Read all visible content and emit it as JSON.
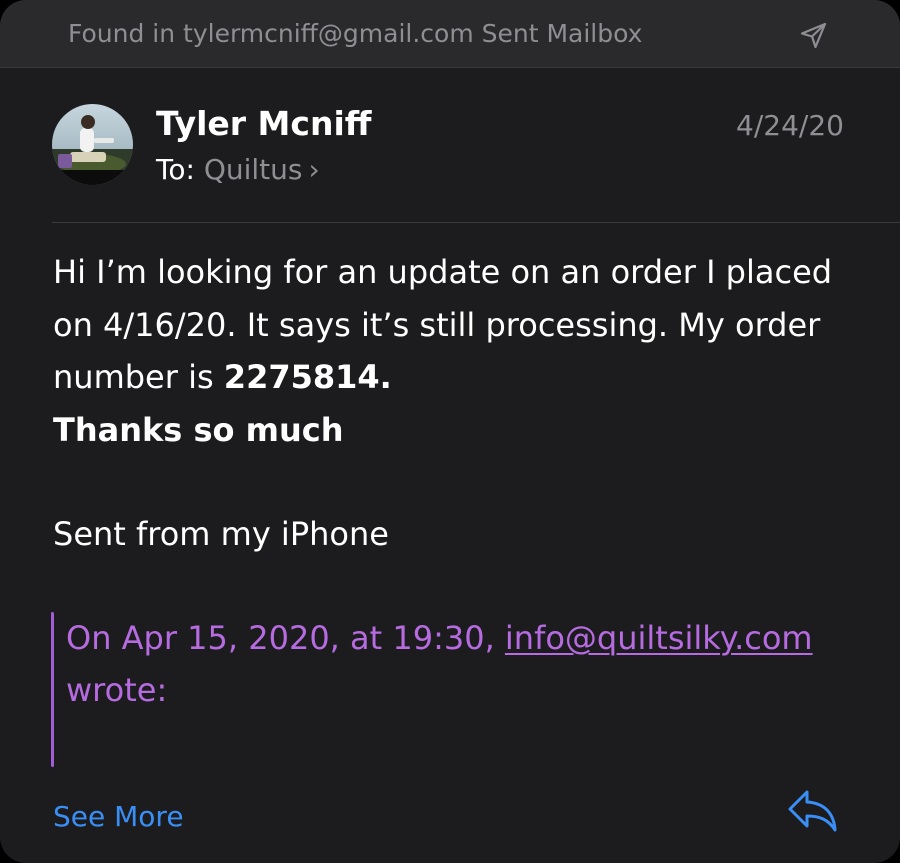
{
  "header": {
    "found_in": "Found in tylermcniff@gmail.com Sent Mailbox",
    "send_icon": "paper-plane-icon"
  },
  "message": {
    "sender": "Tyler Mcniff",
    "to_label": "To:",
    "to_value": "Quiltus",
    "to_chevron": "›",
    "date": "4/24/20",
    "body": {
      "line1": "Hi I’m looking for an update on an order I placed",
      "line2": "on 4/16/20. It says it’s still processing. My order",
      "line3_prefix": "number is ",
      "order_number": "2275814.",
      "line4": "Thanks so much"
    },
    "signature": "Sent from my iPhone",
    "quote": {
      "prefix": "On Apr 15, 2020, at 19:30, ",
      "email": "info@quiltsilky.com",
      "suffix": "wrote:"
    }
  },
  "footer": {
    "see_more": "See More",
    "reply_icon": "reply-arrow-icon"
  },
  "colors": {
    "background": "#1c1c1e",
    "accent_blue": "#3a8ff7",
    "quote_purple": "#b66be0",
    "secondary_text": "#8e8e93"
  }
}
